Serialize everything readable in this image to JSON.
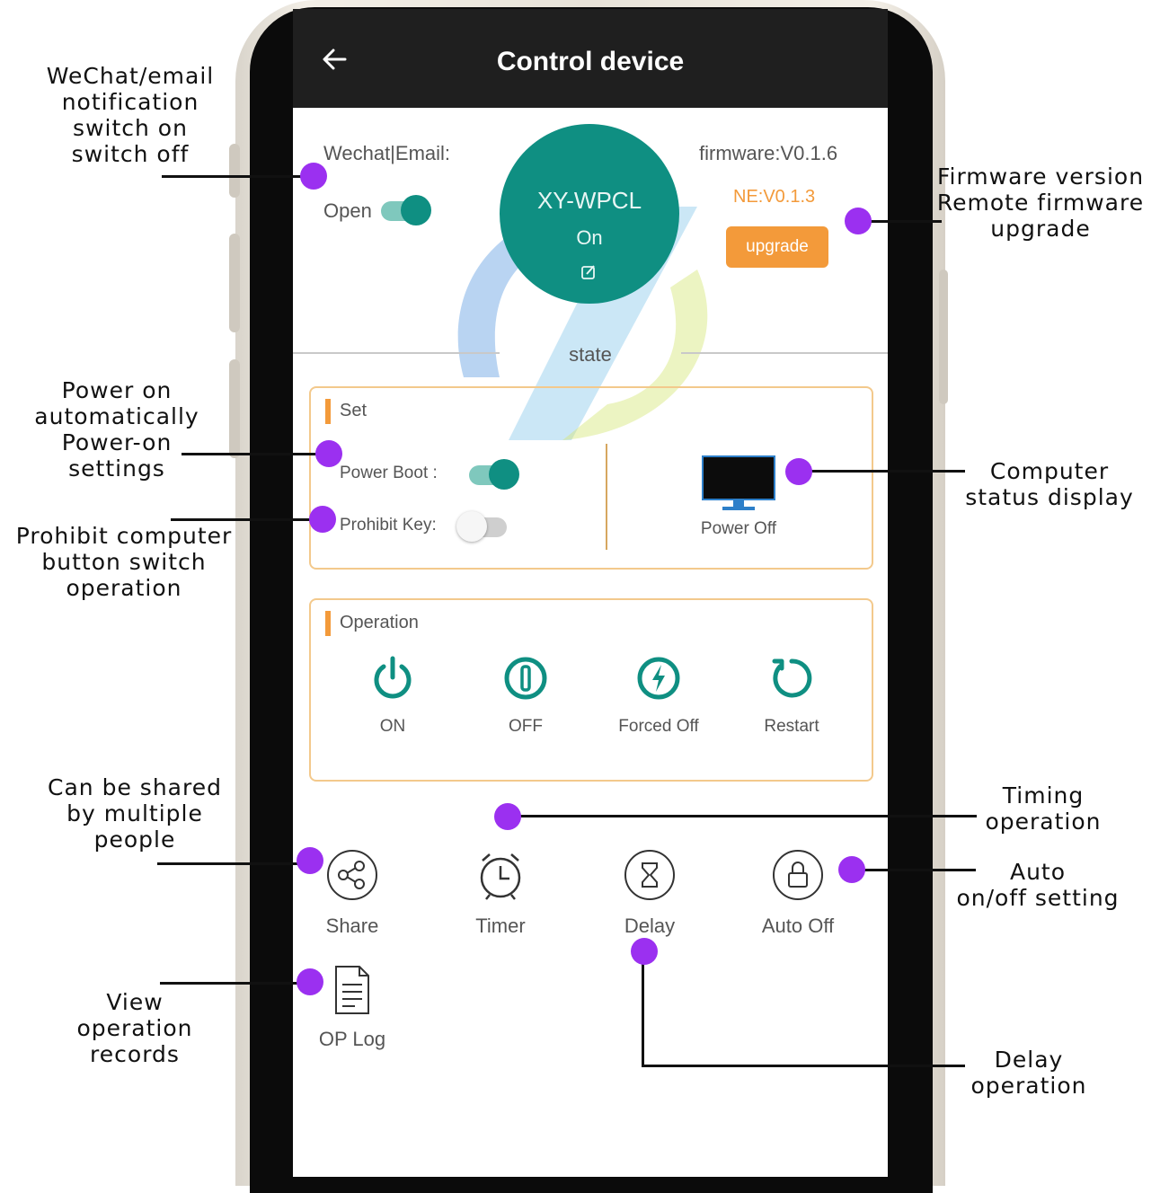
{
  "app": {
    "title": "Control device",
    "back_icon": "back-arrow-icon"
  },
  "notify": {
    "label": "Wechat|Email:",
    "toggle_label": "Open",
    "enabled": true
  },
  "device": {
    "name": "XY-WPCL",
    "state": "On",
    "edit_icon": "edit-icon"
  },
  "firmware": {
    "version": "firmware:V0.1.6",
    "ne_version": "NE:V0.1.3",
    "upgrade_label": "upgrade"
  },
  "state_label": "state",
  "set_panel": {
    "title": "Set",
    "power_boot_label": "Power Boot :",
    "power_boot_on": true,
    "prohibit_key_label": "Prohibit Key:",
    "prohibit_key_on": false,
    "computer_status": "Power Off",
    "computer_icon": "monitor-icon"
  },
  "operation_panel": {
    "title": "Operation",
    "buttons": [
      {
        "label": "ON",
        "icon": "power-on-icon"
      },
      {
        "label": "OFF",
        "icon": "power-off-icon"
      },
      {
        "label": "Forced Off",
        "icon": "forced-off-icon"
      },
      {
        "label": "Restart",
        "icon": "restart-icon"
      }
    ]
  },
  "features": [
    {
      "label": "Share",
      "icon": "share-icon"
    },
    {
      "label": "Timer",
      "icon": "alarm-clock-icon"
    },
    {
      "label": "Delay",
      "icon": "hourglass-icon"
    },
    {
      "label": "Auto Off",
      "icon": "lock-icon"
    },
    {
      "label": "OP Log",
      "icon": "document-icon"
    }
  ],
  "annotations": {
    "wechat": [
      "WeChat/email",
      "notification",
      "switch on",
      "switch off"
    ],
    "firmware": [
      "Firmware version",
      "Remote firmware",
      "upgrade"
    ],
    "power_on": [
      "Power on",
      "automatically",
      "Power-on",
      "settings"
    ],
    "prohibit": [
      "Prohibit computer",
      "button switch",
      "operation"
    ],
    "computer_status": [
      "Computer",
      "status display"
    ],
    "share": [
      "Can be shared",
      "by multiple",
      "people"
    ],
    "timing": [
      "Timing",
      "operation"
    ],
    "auto": [
      "Auto",
      "on/off setting"
    ],
    "view": [
      "View",
      "operation",
      "records"
    ],
    "delay": [
      "Delay",
      "operation"
    ]
  },
  "colors": {
    "accent_teal": "#0f8f82",
    "accent_orange": "#f39a3a",
    "annotation_dot": "#9b30f0",
    "header_bg": "#1f1f1f"
  }
}
